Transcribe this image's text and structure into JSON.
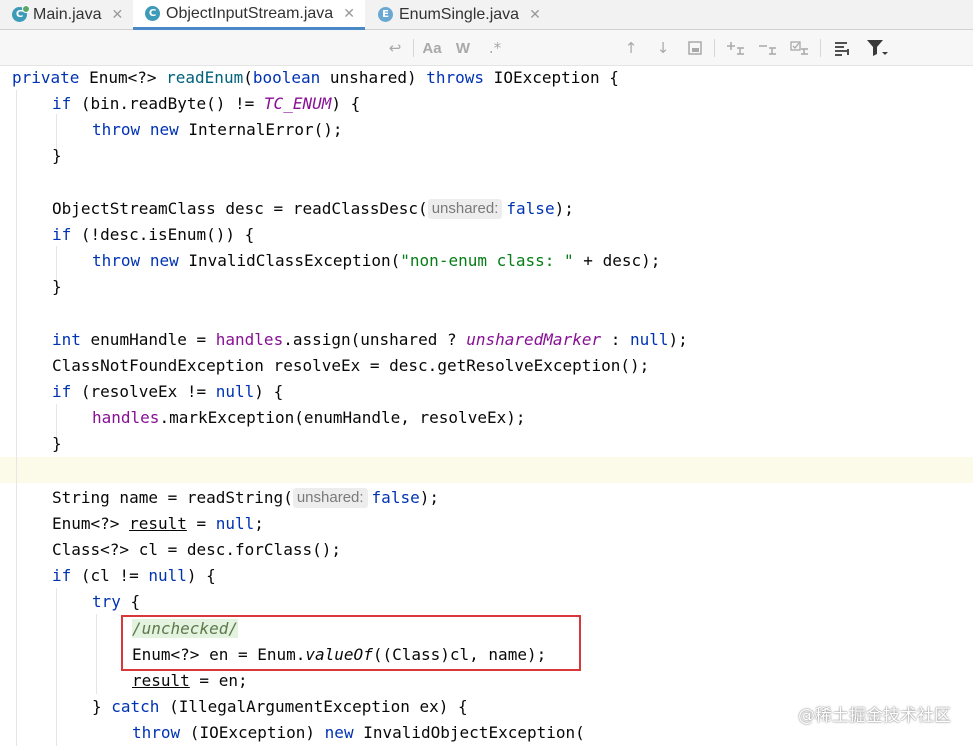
{
  "tabs": [
    {
      "label": "Main.java",
      "icon": "java-class-icon",
      "close": "✕"
    },
    {
      "label": "ObjectInputStream.java",
      "icon": "java-class-icon",
      "close": "✕"
    },
    {
      "label": "EnumSingle.java",
      "icon": "java-enum-icon",
      "close": "✕"
    }
  ],
  "icons": {
    "class_letter": "C",
    "enum_letter": "E"
  },
  "toolbar": {
    "match_case": "Aa",
    "words": "W",
    "regex": ".*"
  },
  "code": {
    "l1": {
      "a": "private",
      "b": " Enum<?> ",
      "c": "readEnum",
      "d": "(",
      "e": "boolean",
      "f": " unshared) ",
      "g": "throws",
      "h": " IOException {"
    },
    "l2": {
      "a": "if",
      "b": " (bin.readByte() != ",
      "c": "TC_ENUM",
      "d": ") {"
    },
    "l3": {
      "a": "throw",
      "b": " ",
      "c": "new",
      "d": " InternalError();"
    },
    "l4": "}",
    "l6": {
      "a": "ObjectStreamClass desc = readClassDesc(",
      "hint": "unshared:",
      "b": "false",
      "c": ");"
    },
    "l7": {
      "a": "if",
      "b": " (!desc.isEnum()) {"
    },
    "l8": {
      "a": "throw",
      "b": " ",
      "c": "new",
      "d": " InvalidClassException(",
      "e": "\"non-enum class: \"",
      "f": " + desc);"
    },
    "l9": "}",
    "l11": {
      "a": "int",
      "b": " enumHandle = ",
      "c": "handles",
      "d": ".assign(unshared ? ",
      "e": "unsharedMarker",
      "f": " : ",
      "g": "null",
      "h": ");"
    },
    "l12": "ClassNotFoundException resolveEx = desc.getResolveException();",
    "l13": {
      "a": "if",
      "b": " (resolveEx != ",
      "c": "null",
      "d": ") {"
    },
    "l14": {
      "a": "handles",
      "b": ".markException(enumHandle, resolveEx);"
    },
    "l15": "}",
    "l17": {
      "a": "String name = readString(",
      "hint": "unshared:",
      "b": "false",
      "c": ");"
    },
    "l18": {
      "a": "Enum<?> ",
      "b": "result",
      "c": " = ",
      "d": "null",
      "e": ";"
    },
    "l19": "Class<?> cl = desc.forClass();",
    "l20": {
      "a": "if",
      "b": " (cl != ",
      "c": "null",
      "d": ") {"
    },
    "l21": {
      "a": "try",
      "b": " {"
    },
    "l22": "/unchecked/",
    "l23": {
      "a": "Enum<?> en = Enum.",
      "b": "valueOf",
      "c": "((Class)cl, name);"
    },
    "l24": {
      "a": "result",
      "b": " = en;"
    },
    "l25": {
      "a": "} ",
      "b": "catch",
      "c": " (IllegalArgumentException ex) {"
    },
    "l26": {
      "a": "throw",
      "b": " (IOException) ",
      "c": "new",
      "d": " InvalidObjectException("
    }
  },
  "watermark": "@稀土掘金技术社区",
  "colors": {
    "keyword": "#0033b3",
    "method": "#00627a",
    "field": "#871094",
    "string": "#067d17",
    "highlight_box": "#d9383a"
  }
}
